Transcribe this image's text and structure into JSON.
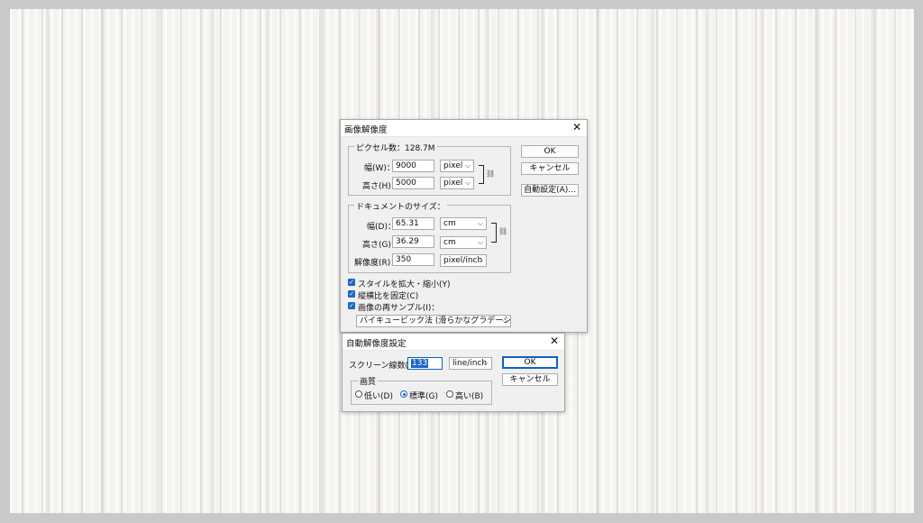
{
  "image_size_dialog": {
    "title": "画像解像度",
    "pixel_dimensions": {
      "legend": "ピクセル数：128.7M",
      "width_label": "幅(W)：",
      "width_value": "9000",
      "width_unit": "pixel",
      "height_label": "高さ(H)：",
      "height_value": "5000",
      "height_unit": "pixel"
    },
    "document_size": {
      "legend": "ドキュメントのサイズ：",
      "width_label": "幅(D)：",
      "width_value": "65.31",
      "width_unit": "cm",
      "height_label": "高さ(G)：",
      "height_value": "36.29",
      "height_unit": "cm",
      "resolution_label": "解像度(R)：",
      "resolution_value": "350",
      "resolution_unit": "pixel/inch"
    },
    "options": {
      "scale_styles": "スタイルを拡大・縮小(Y)",
      "constrain_proportions": "縦横比を固定(C)",
      "resample": "画像の再サンプル(I)："
    },
    "resample_method": "バイキュービック法 (滑らかなグラデーションに最適)",
    "buttons": {
      "ok": "OK",
      "cancel": "キャンセル",
      "auto": "自動設定(A)..."
    }
  },
  "auto_resolution_dialog": {
    "title": "自動解像度設定",
    "screen_label": "スクリーン線数(S)：",
    "screen_value": "133",
    "screen_unit": "line/inch",
    "quality_legend": "画質",
    "quality_low": "低い(D)",
    "quality_standard": "標準(G)",
    "quality_high": "高い(B)",
    "buttons": {
      "ok": "OK",
      "cancel": "キャンセル"
    }
  },
  "icons": {
    "close": "close-icon",
    "chain": "chain-link-icon",
    "chevron": "chevron-down-icon",
    "check": "checkmark-icon"
  },
  "colors": {
    "accent": "#1f65c7",
    "dialog_bg": "#f0f0f0",
    "canvas_bg": "#f4f3ef"
  }
}
